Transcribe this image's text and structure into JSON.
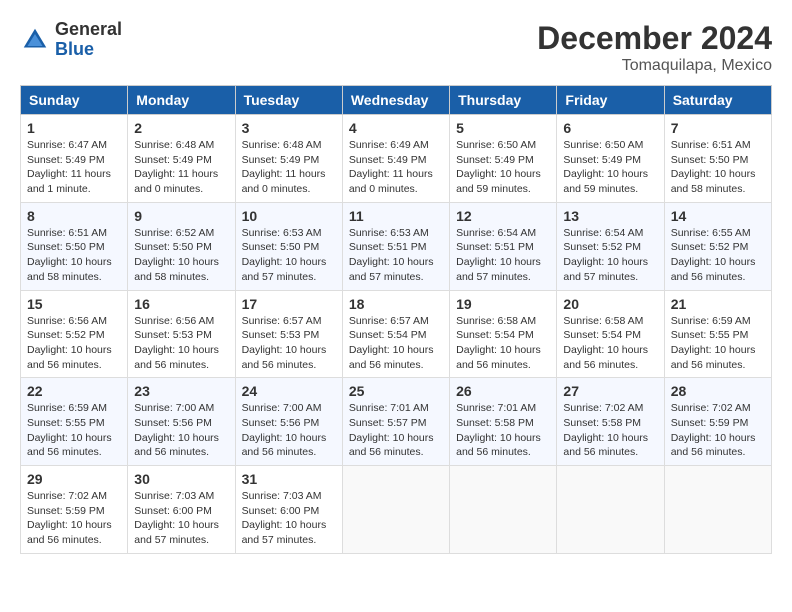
{
  "header": {
    "logo_general": "General",
    "logo_blue": "Blue",
    "month_title": "December 2024",
    "location": "Tomaquilapa, Mexico"
  },
  "days_of_week": [
    "Sunday",
    "Monday",
    "Tuesday",
    "Wednesday",
    "Thursday",
    "Friday",
    "Saturday"
  ],
  "weeks": [
    [
      {
        "day": "1",
        "info": "Sunrise: 6:47 AM\nSunset: 5:49 PM\nDaylight: 11 hours and 1 minute."
      },
      {
        "day": "2",
        "info": "Sunrise: 6:48 AM\nSunset: 5:49 PM\nDaylight: 11 hours and 0 minutes."
      },
      {
        "day": "3",
        "info": "Sunrise: 6:48 AM\nSunset: 5:49 PM\nDaylight: 11 hours and 0 minutes."
      },
      {
        "day": "4",
        "info": "Sunrise: 6:49 AM\nSunset: 5:49 PM\nDaylight: 11 hours and 0 minutes."
      },
      {
        "day": "5",
        "info": "Sunrise: 6:50 AM\nSunset: 5:49 PM\nDaylight: 10 hours and 59 minutes."
      },
      {
        "day": "6",
        "info": "Sunrise: 6:50 AM\nSunset: 5:49 PM\nDaylight: 10 hours and 59 minutes."
      },
      {
        "day": "7",
        "info": "Sunrise: 6:51 AM\nSunset: 5:50 PM\nDaylight: 10 hours and 58 minutes."
      }
    ],
    [
      {
        "day": "8",
        "info": "Sunrise: 6:51 AM\nSunset: 5:50 PM\nDaylight: 10 hours and 58 minutes."
      },
      {
        "day": "9",
        "info": "Sunrise: 6:52 AM\nSunset: 5:50 PM\nDaylight: 10 hours and 58 minutes."
      },
      {
        "day": "10",
        "info": "Sunrise: 6:53 AM\nSunset: 5:50 PM\nDaylight: 10 hours and 57 minutes."
      },
      {
        "day": "11",
        "info": "Sunrise: 6:53 AM\nSunset: 5:51 PM\nDaylight: 10 hours and 57 minutes."
      },
      {
        "day": "12",
        "info": "Sunrise: 6:54 AM\nSunset: 5:51 PM\nDaylight: 10 hours and 57 minutes."
      },
      {
        "day": "13",
        "info": "Sunrise: 6:54 AM\nSunset: 5:52 PM\nDaylight: 10 hours and 57 minutes."
      },
      {
        "day": "14",
        "info": "Sunrise: 6:55 AM\nSunset: 5:52 PM\nDaylight: 10 hours and 56 minutes."
      }
    ],
    [
      {
        "day": "15",
        "info": "Sunrise: 6:56 AM\nSunset: 5:52 PM\nDaylight: 10 hours and 56 minutes."
      },
      {
        "day": "16",
        "info": "Sunrise: 6:56 AM\nSunset: 5:53 PM\nDaylight: 10 hours and 56 minutes."
      },
      {
        "day": "17",
        "info": "Sunrise: 6:57 AM\nSunset: 5:53 PM\nDaylight: 10 hours and 56 minutes."
      },
      {
        "day": "18",
        "info": "Sunrise: 6:57 AM\nSunset: 5:54 PM\nDaylight: 10 hours and 56 minutes."
      },
      {
        "day": "19",
        "info": "Sunrise: 6:58 AM\nSunset: 5:54 PM\nDaylight: 10 hours and 56 minutes."
      },
      {
        "day": "20",
        "info": "Sunrise: 6:58 AM\nSunset: 5:54 PM\nDaylight: 10 hours and 56 minutes."
      },
      {
        "day": "21",
        "info": "Sunrise: 6:59 AM\nSunset: 5:55 PM\nDaylight: 10 hours and 56 minutes."
      }
    ],
    [
      {
        "day": "22",
        "info": "Sunrise: 6:59 AM\nSunset: 5:55 PM\nDaylight: 10 hours and 56 minutes."
      },
      {
        "day": "23",
        "info": "Sunrise: 7:00 AM\nSunset: 5:56 PM\nDaylight: 10 hours and 56 minutes."
      },
      {
        "day": "24",
        "info": "Sunrise: 7:00 AM\nSunset: 5:56 PM\nDaylight: 10 hours and 56 minutes."
      },
      {
        "day": "25",
        "info": "Sunrise: 7:01 AM\nSunset: 5:57 PM\nDaylight: 10 hours and 56 minutes."
      },
      {
        "day": "26",
        "info": "Sunrise: 7:01 AM\nSunset: 5:58 PM\nDaylight: 10 hours and 56 minutes."
      },
      {
        "day": "27",
        "info": "Sunrise: 7:02 AM\nSunset: 5:58 PM\nDaylight: 10 hours and 56 minutes."
      },
      {
        "day": "28",
        "info": "Sunrise: 7:02 AM\nSunset: 5:59 PM\nDaylight: 10 hours and 56 minutes."
      }
    ],
    [
      {
        "day": "29",
        "info": "Sunrise: 7:02 AM\nSunset: 5:59 PM\nDaylight: 10 hours and 56 minutes."
      },
      {
        "day": "30",
        "info": "Sunrise: 7:03 AM\nSunset: 6:00 PM\nDaylight: 10 hours and 57 minutes."
      },
      {
        "day": "31",
        "info": "Sunrise: 7:03 AM\nSunset: 6:00 PM\nDaylight: 10 hours and 57 minutes."
      },
      {
        "day": "",
        "info": ""
      },
      {
        "day": "",
        "info": ""
      },
      {
        "day": "",
        "info": ""
      },
      {
        "day": "",
        "info": ""
      }
    ]
  ]
}
